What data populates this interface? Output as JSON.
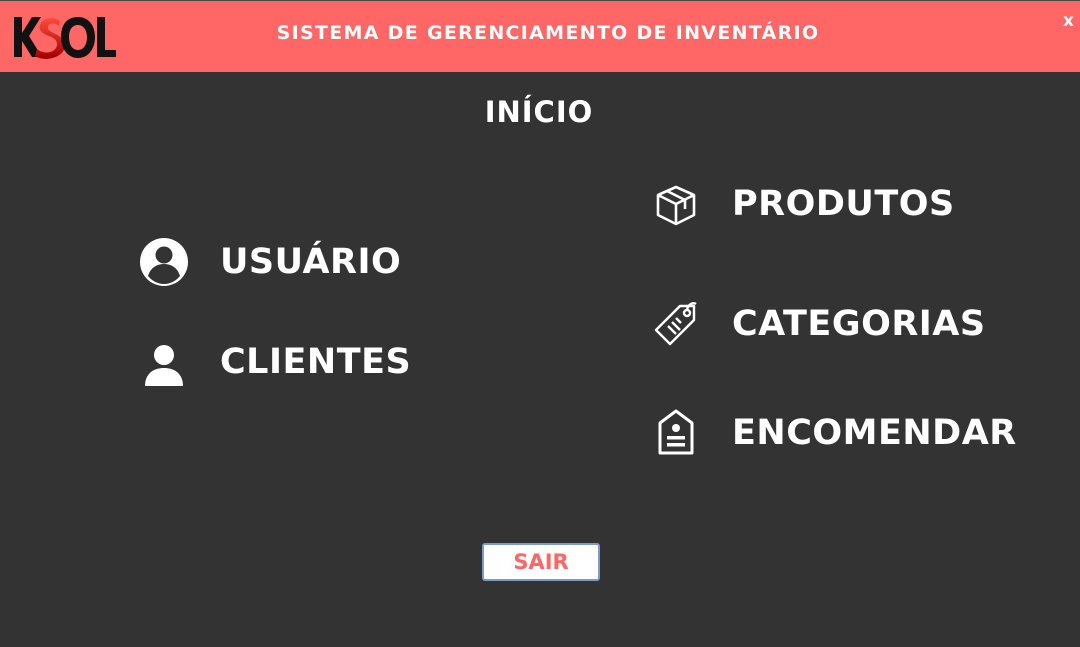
{
  "header": {
    "logo_text": "KSOL",
    "title": "SISTEMA DE GERENCIAMENTO DE INVENTÁRIO",
    "close_label": "x"
  },
  "page": {
    "title": "INÍCIO"
  },
  "menu": {
    "usuario": {
      "label": "USUÁRIO",
      "icon": "user-circle-icon"
    },
    "clientes": {
      "label": "CLIENTES",
      "icon": "person-icon"
    },
    "produtos": {
      "label": "PRODUTOS",
      "icon": "box-icon"
    },
    "categorias": {
      "label": "CATEGORIAS",
      "icon": "tag-icon"
    },
    "encomendar": {
      "label": "ENCOMENDAR",
      "icon": "order-icon"
    }
  },
  "actions": {
    "exit_label": "SAIR"
  },
  "colors": {
    "header": "#FF6666",
    "background": "#333333",
    "text": "#FFFFFF",
    "accent": "#FF6666"
  }
}
